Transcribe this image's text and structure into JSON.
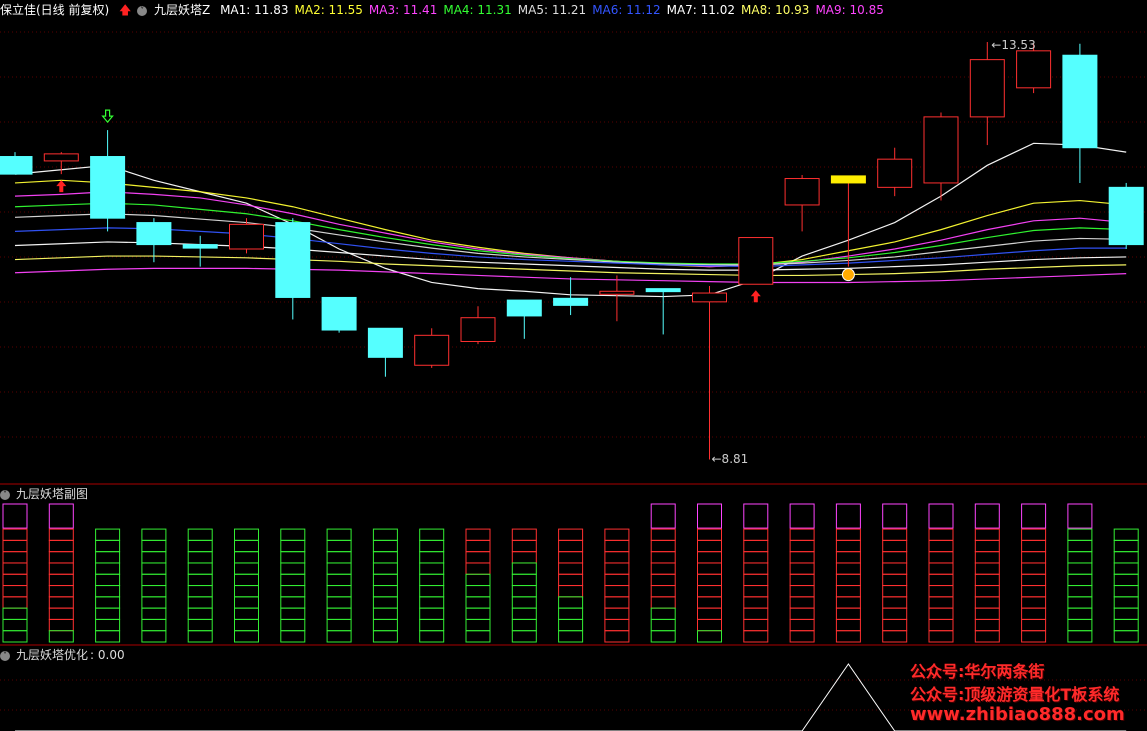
{
  "header": {
    "stock_title": "保立佳(日线 前复权)",
    "indicator_name": "九层妖塔Z",
    "ma": [
      {
        "label": "MA1:",
        "value": "11.83",
        "color": "#ffffff"
      },
      {
        "label": "MA2:",
        "value": "11.55",
        "color": "#ffff33"
      },
      {
        "label": "MA3:",
        "value": "11.41",
        "color": "#ff44ff"
      },
      {
        "label": "MA4:",
        "value": "11.31",
        "color": "#33ff33"
      },
      {
        "label": "MA5:",
        "value": "11.21",
        "color": "#dddddd"
      },
      {
        "label": "MA6:",
        "value": "11.12",
        "color": "#3355ff"
      },
      {
        "label": "MA7:",
        "value": "11.02",
        "color": "#ffffff"
      },
      {
        "label": "MA8:",
        "value": "10.93",
        "color": "#ffff66"
      },
      {
        "label": "MA9:",
        "value": "10.85",
        "color": "#ff44ff"
      }
    ]
  },
  "panel2": {
    "title": "九层妖塔副图"
  },
  "panel3": {
    "title": "九层妖塔优化",
    "value_text": ": 0.00"
  },
  "watermark": {
    "line1": "公众号:华尔两条街",
    "line2": "公众号:顶级游资量化T板系统",
    "line3": "www.zhibiao888.com"
  },
  "chart_data": [
    {
      "type": "candlestick",
      "title": "保立佳(日线 前复权)",
      "high_label": "13.53",
      "low_label": "8.81",
      "ylim": [
        8.6,
        13.8
      ],
      "candles": [
        {
          "o": 12.25,
          "h": 12.3,
          "c": 12.05,
          "l": 12.05,
          "dir": "down"
        },
        {
          "o": 12.2,
          "h": 12.3,
          "c": 12.28,
          "l": 12.05,
          "dir": "up"
        },
        {
          "o": 12.25,
          "h": 12.55,
          "c": 11.55,
          "l": 11.4,
          "dir": "down"
        },
        {
          "o": 11.5,
          "h": 11.55,
          "c": 11.25,
          "l": 11.05,
          "dir": "down"
        },
        {
          "o": 11.25,
          "h": 11.35,
          "c": 11.21,
          "l": 11.0,
          "dir": "down"
        },
        {
          "o": 11.2,
          "h": 11.55,
          "c": 11.48,
          "l": 11.15,
          "dir": "up"
        },
        {
          "o": 11.5,
          "h": 11.55,
          "c": 10.65,
          "l": 10.4,
          "dir": "down"
        },
        {
          "o": 10.65,
          "h": 10.65,
          "c": 10.28,
          "l": 10.25,
          "dir": "down"
        },
        {
          "o": 10.3,
          "h": 10.3,
          "c": 9.97,
          "l": 9.75,
          "dir": "down"
        },
        {
          "o": 9.88,
          "h": 10.3,
          "c": 10.22,
          "l": 9.85,
          "dir": "up"
        },
        {
          "o": 10.15,
          "h": 10.55,
          "c": 10.42,
          "l": 10.12,
          "dir": "up"
        },
        {
          "o": 10.62,
          "h": 10.62,
          "c": 10.44,
          "l": 10.18,
          "dir": "down"
        },
        {
          "o": 10.64,
          "h": 10.88,
          "c": 10.56,
          "l": 10.45,
          "dir": "down"
        },
        {
          "o": 10.7,
          "h": 10.9,
          "c": 10.72,
          "l": 10.38,
          "dir": "up"
        },
        {
          "o": 10.75,
          "h": 10.75,
          "c": 10.73,
          "l": 10.23,
          "dir": "down"
        },
        {
          "o": 10.6,
          "h": 10.78,
          "c": 10.7,
          "l": 8.81,
          "dir": "up"
        },
        {
          "o": 10.8,
          "h": 11.33,
          "c": 11.33,
          "l": 10.8,
          "dir": "up"
        },
        {
          "o": 11.7,
          "h": 12.04,
          "c": 12.0,
          "l": 11.4,
          "dir": "up"
        },
        {
          "o": 11.95,
          "h": 12.03,
          "c": 12.03,
          "l": 11.0,
          "dir": "up",
          "yellow": true
        },
        {
          "o": 11.9,
          "h": 12.35,
          "c": 12.22,
          "l": 11.8,
          "dir": "up"
        },
        {
          "o": 11.95,
          "h": 12.75,
          "c": 12.7,
          "l": 11.75,
          "dir": "up"
        },
        {
          "o": 12.7,
          "h": 13.55,
          "c": 13.35,
          "l": 12.38,
          "dir": "up"
        },
        {
          "o": 13.03,
          "h": 13.53,
          "c": 13.45,
          "l": 12.97,
          "dir": "up"
        },
        {
          "o": 13.4,
          "h": 13.53,
          "c": 12.35,
          "l": 11.95,
          "dir": "down"
        },
        {
          "o": 11.9,
          "h": 11.95,
          "c": 11.25,
          "l": 11.2,
          "dir": "down"
        }
      ],
      "ma_lines": [
        {
          "name": "MA1",
          "color": "#ffffff",
          "values": [
            12.05,
            12.1,
            12.15,
            11.98,
            11.85,
            11.72,
            11.48,
            11.2,
            10.98,
            10.82,
            10.75,
            10.72,
            10.68,
            10.67,
            10.66,
            10.68,
            10.85,
            11.12,
            11.3,
            11.5,
            11.8,
            12.15,
            12.4,
            12.38,
            12.3
          ]
        },
        {
          "name": "MA2",
          "color": "#ffff33",
          "values": [
            11.95,
            11.98,
            11.95,
            11.9,
            11.85,
            11.78,
            11.68,
            11.55,
            11.42,
            11.3,
            11.22,
            11.15,
            11.1,
            11.06,
            11.02,
            11.0,
            11.02,
            11.08,
            11.18,
            11.28,
            11.42,
            11.58,
            11.72,
            11.75,
            11.7
          ]
        },
        {
          "name": "MA3",
          "color": "#ff44ff",
          "values": [
            11.8,
            11.82,
            11.85,
            11.82,
            11.78,
            11.7,
            11.6,
            11.48,
            11.38,
            11.28,
            11.2,
            11.14,
            11.1,
            11.06,
            11.03,
            11.0,
            11.02,
            11.05,
            11.12,
            11.2,
            11.3,
            11.42,
            11.52,
            11.55,
            11.5
          ]
        },
        {
          "name": "MA4",
          "color": "#33ff33",
          "values": [
            11.68,
            11.7,
            11.72,
            11.7,
            11.65,
            11.6,
            11.52,
            11.42,
            11.33,
            11.25,
            11.18,
            11.13,
            11.09,
            11.06,
            11.04,
            11.03,
            11.03,
            11.06,
            11.1,
            11.16,
            11.24,
            11.33,
            11.41,
            11.44,
            11.42
          ]
        },
        {
          "name": "MA5",
          "color": "#dddddd",
          "values": [
            11.56,
            11.58,
            11.6,
            11.58,
            11.54,
            11.5,
            11.44,
            11.36,
            11.28,
            11.21,
            11.15,
            11.11,
            11.08,
            11.05,
            11.03,
            11.02,
            11.02,
            11.04,
            11.07,
            11.11,
            11.17,
            11.23,
            11.29,
            11.32,
            11.31
          ]
        },
        {
          "name": "MA6",
          "color": "#3355ff",
          "values": [
            11.4,
            11.42,
            11.44,
            11.43,
            11.4,
            11.37,
            11.32,
            11.26,
            11.2,
            11.15,
            11.11,
            11.08,
            11.06,
            11.04,
            11.02,
            11.01,
            11.0,
            11.02,
            11.04,
            11.07,
            11.1,
            11.14,
            11.18,
            11.21,
            11.21
          ]
        },
        {
          "name": "MA7",
          "color": "#ffffff",
          "values": [
            11.24,
            11.26,
            11.28,
            11.27,
            11.25,
            11.23,
            11.2,
            11.16,
            11.12,
            11.08,
            11.05,
            11.03,
            11.01,
            10.99,
            10.97,
            10.96,
            10.96,
            10.97,
            10.98,
            11.0,
            11.02,
            11.05,
            11.08,
            11.1,
            11.11
          ]
        },
        {
          "name": "MA8",
          "color": "#ffff66",
          "values": [
            11.08,
            11.1,
            11.12,
            11.12,
            11.11,
            11.1,
            11.08,
            11.06,
            11.03,
            11.01,
            10.99,
            10.97,
            10.95,
            10.93,
            10.92,
            10.91,
            10.9,
            10.9,
            10.91,
            10.92,
            10.94,
            10.97,
            10.99,
            11.01,
            11.02
          ]
        },
        {
          "name": "MA9",
          "color": "#ff44ff",
          "values": [
            10.93,
            10.95,
            10.97,
            10.98,
            10.98,
            10.98,
            10.97,
            10.96,
            10.94,
            10.92,
            10.9,
            10.88,
            10.86,
            10.85,
            10.84,
            10.83,
            10.82,
            10.82,
            10.82,
            10.83,
            10.84,
            10.86,
            10.88,
            10.9,
            10.92
          ]
        }
      ],
      "signals": [
        {
          "index": 1,
          "type": "up-arrow",
          "color": "#ff2222"
        },
        {
          "index": 2,
          "type": "down-arrow",
          "color": "#33ff33"
        },
        {
          "index": 16,
          "type": "up-arrow",
          "color": "#ff2222"
        },
        {
          "index": 18,
          "type": "money-bag",
          "color": "#ffaa00"
        }
      ]
    },
    {
      "type": "tower",
      "title": "九层妖塔副图",
      "levels": 10,
      "columns": [
        {
          "magenta_top": true,
          "red": 7,
          "green": 1
        },
        {
          "magenta_top": true,
          "red": 9,
          "green": 0
        },
        {
          "magenta_top": false,
          "red": 0,
          "green": 10
        },
        {
          "magenta_top": false,
          "red": 0,
          "green": 10
        },
        {
          "magenta_top": false,
          "red": 0,
          "green": 10
        },
        {
          "magenta_top": false,
          "red": 0,
          "green": 10
        },
        {
          "magenta_top": false,
          "red": 0,
          "green": 10
        },
        {
          "magenta_top": false,
          "red": 0,
          "green": 10
        },
        {
          "magenta_top": false,
          "red": 0,
          "green": 10
        },
        {
          "magenta_top": false,
          "red": 0,
          "green": 10
        },
        {
          "magenta_top": false,
          "red": 4,
          "green": 6
        },
        {
          "magenta_top": false,
          "red": 3,
          "green": 7
        },
        {
          "magenta_top": false,
          "red": 6,
          "green": 4
        },
        {
          "magenta_top": false,
          "red": 10,
          "green": 0
        },
        {
          "magenta_top": true,
          "red": 7,
          "green": 3
        },
        {
          "magenta_top": true,
          "red": 9,
          "green": 1
        },
        {
          "magenta_top": true,
          "red": 10,
          "green": 0
        },
        {
          "magenta_top": true,
          "red": 10,
          "green": 0
        },
        {
          "magenta_top": true,
          "red": 10,
          "green": 0
        },
        {
          "magenta_top": true,
          "red": 10,
          "green": 0
        },
        {
          "magenta_top": true,
          "red": 10,
          "green": 0
        },
        {
          "magenta_top": true,
          "red": 10,
          "green": 0
        },
        {
          "magenta_top": true,
          "red": 10,
          "green": 0
        },
        {
          "magenta_top": true,
          "red": 0,
          "green": 10
        },
        {
          "magenta_top": false,
          "red": 0,
          "green": 10
        }
      ]
    },
    {
      "type": "line",
      "title": "九层妖塔优化",
      "values": [
        0,
        0,
        0,
        0,
        0,
        0,
        0,
        0,
        0,
        0,
        0,
        0,
        0,
        0,
        0,
        0,
        0,
        0,
        1,
        0,
        0,
        0,
        0,
        0,
        0
      ],
      "color": "#ffffff"
    }
  ]
}
